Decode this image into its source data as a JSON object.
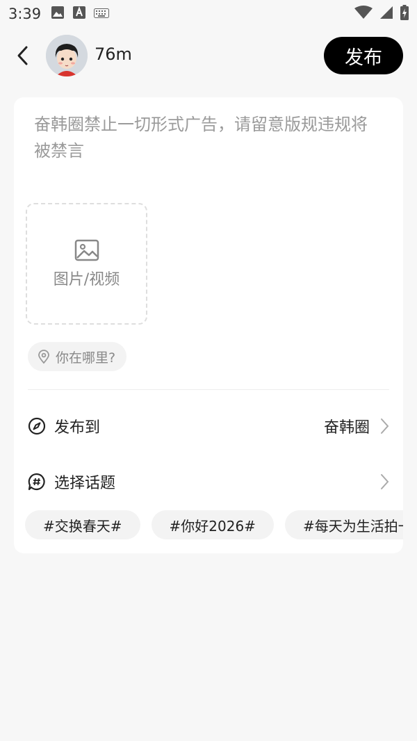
{
  "status_bar": {
    "time": "3:39"
  },
  "header": {
    "username": "76m",
    "publish_label": "发布"
  },
  "composer": {
    "placeholder": "奋韩圈禁止一切形式广告，请留意版规违规将被禁言",
    "media_label": "图片/视频",
    "location_label": "你在哪里?"
  },
  "publish_to": {
    "label": "发布到",
    "value": "奋韩圈"
  },
  "topic_select": {
    "label": "选择话题"
  },
  "topics": [
    "#交换春天#",
    "#你好2026#",
    "#每天为生活拍一张照#"
  ],
  "colors": {
    "accent": "#000000",
    "card_bg": "#ffffff",
    "page_bg": "#f7f7f7",
    "placeholder": "#9a9a9a"
  }
}
